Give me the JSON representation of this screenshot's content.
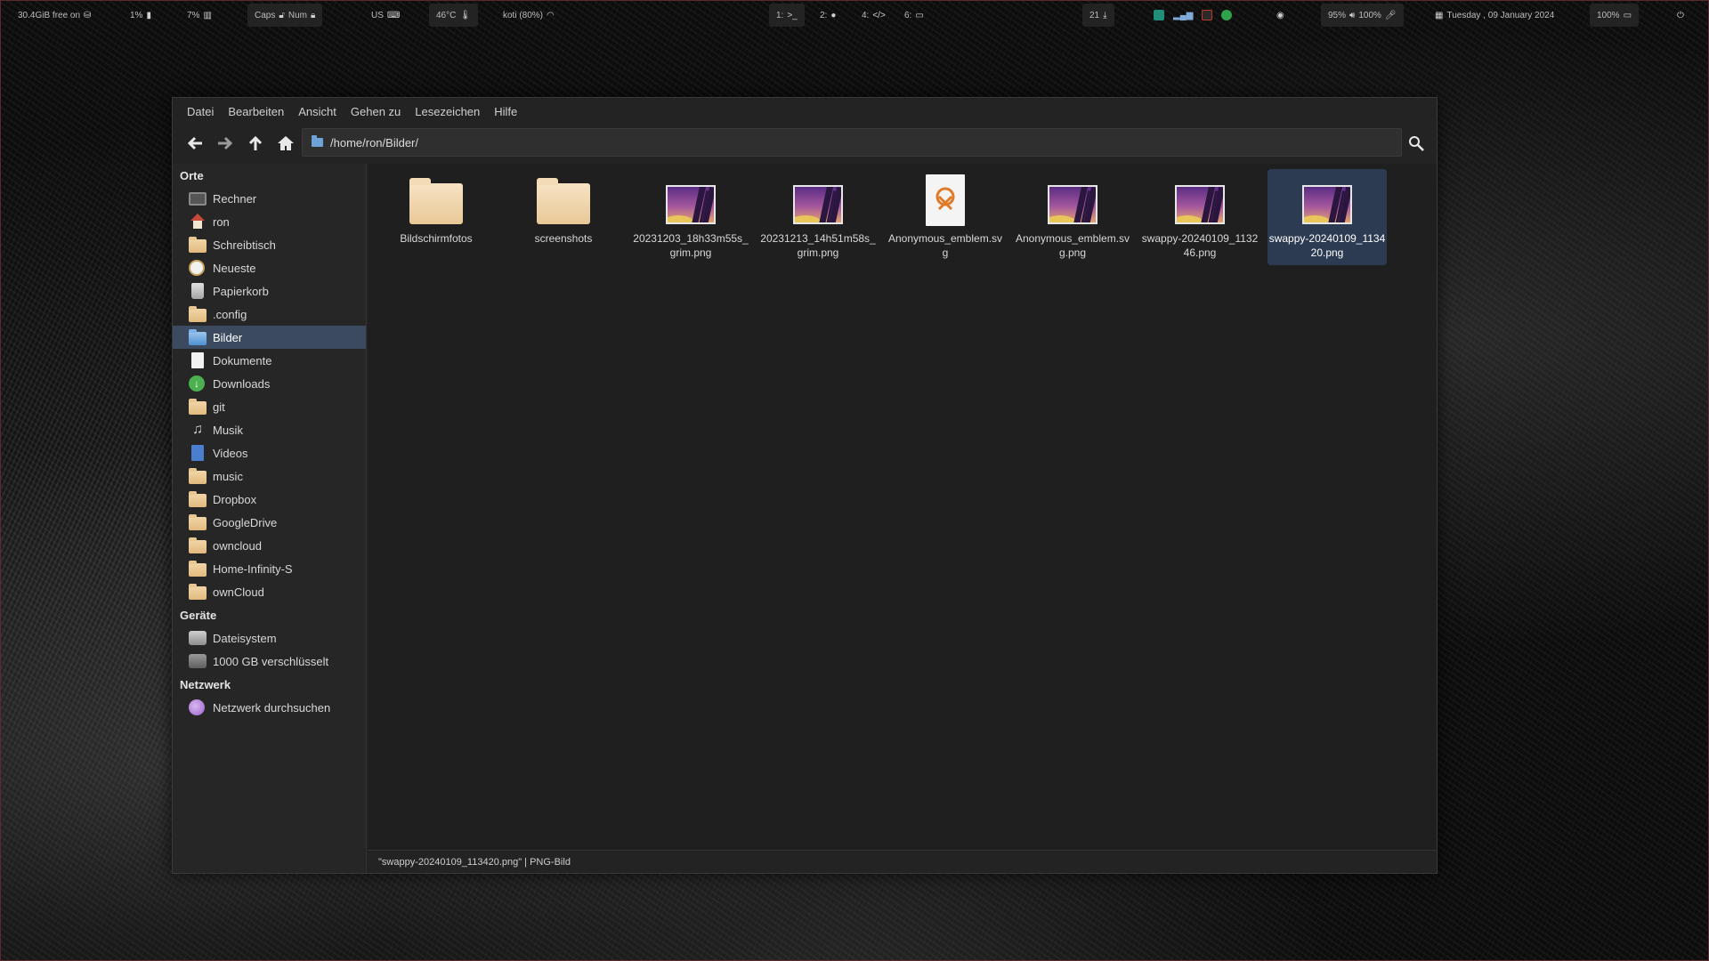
{
  "topbar": {
    "disk": "30.4GiB free on",
    "battery_small": "1%",
    "cpu": "7%",
    "caps": "Caps",
    "num": "Num",
    "layout": "US",
    "temp": "46°C",
    "wifi": "koti (80%)",
    "ws1": "1:",
    "ws2": "2:",
    "ws4": "4:",
    "ws6": "6:",
    "updates": "21",
    "brightness": "95%",
    "volume": "100%",
    "date": "Tuesday , 09 January 2024",
    "battery": "100%"
  },
  "menu": [
    "Datei",
    "Bearbeiten",
    "Ansicht",
    "Gehen zu",
    "Lesezeichen",
    "Hilfe"
  ],
  "path": "/home/ron/Bilder/",
  "sidebar": {
    "places_heading": "Orte",
    "places": [
      {
        "label": "Rechner",
        "icon": "monitor-icon"
      },
      {
        "label": "ron",
        "icon": "home-icon"
      },
      {
        "label": "Schreibtisch",
        "icon": "folder-icon"
      },
      {
        "label": "Neueste",
        "icon": "clock-icon"
      },
      {
        "label": "Papierkorb",
        "icon": "trash-icon"
      },
      {
        "label": ".config",
        "icon": "folder-icon"
      },
      {
        "label": "Bilder",
        "icon": "pictures-folder-icon"
      },
      {
        "label": "Dokumente",
        "icon": "document-icon"
      },
      {
        "label": "Downloads",
        "icon": "download-icon"
      },
      {
        "label": "git",
        "icon": "folder-icon"
      },
      {
        "label": "Musik",
        "icon": "music-icon"
      },
      {
        "label": "Videos",
        "icon": "video-icon"
      },
      {
        "label": "music",
        "icon": "folder-icon"
      },
      {
        "label": "Dropbox",
        "icon": "folder-icon"
      },
      {
        "label": "GoogleDrive",
        "icon": "folder-icon"
      },
      {
        "label": "owncloud",
        "icon": "folder-icon"
      },
      {
        "label": "Home-Infinity-S",
        "icon": "folder-icon"
      },
      {
        "label": "ownCloud",
        "icon": "folder-icon"
      }
    ],
    "devices_heading": "Geräte",
    "devices": [
      {
        "label": "Dateisystem",
        "icon": "drive-icon"
      },
      {
        "label": "1000 GB verschlüsselt",
        "icon": "encrypted-drive-icon"
      }
    ],
    "network_heading": "Netzwerk",
    "network": [
      {
        "label": "Netzwerk durchsuchen",
        "icon": "network-icon"
      }
    ]
  },
  "files": [
    {
      "name": "Bildschirmfotos",
      "type": "folder"
    },
    {
      "name": "screenshots",
      "type": "folder"
    },
    {
      "name": "20231203_18h33m55s_grim.png",
      "type": "image"
    },
    {
      "name": "20231213_14h51m58s_grim.png",
      "type": "image"
    },
    {
      "name": "Anonymous_emblem.svg",
      "type": "svg"
    },
    {
      "name": "Anonymous_emblem.svg.png",
      "type": "image"
    },
    {
      "name": "swappy-20240109_113246.png",
      "type": "image"
    },
    {
      "name": "swappy-20240109_113420.png",
      "type": "image"
    }
  ],
  "status": "\"swappy-20240109_113420.png\"  |  PNG-Bild",
  "colors": {
    "selection": "#2d3b52",
    "sidebar_active": "#3b4a5f",
    "background": "#1f1f1f"
  }
}
